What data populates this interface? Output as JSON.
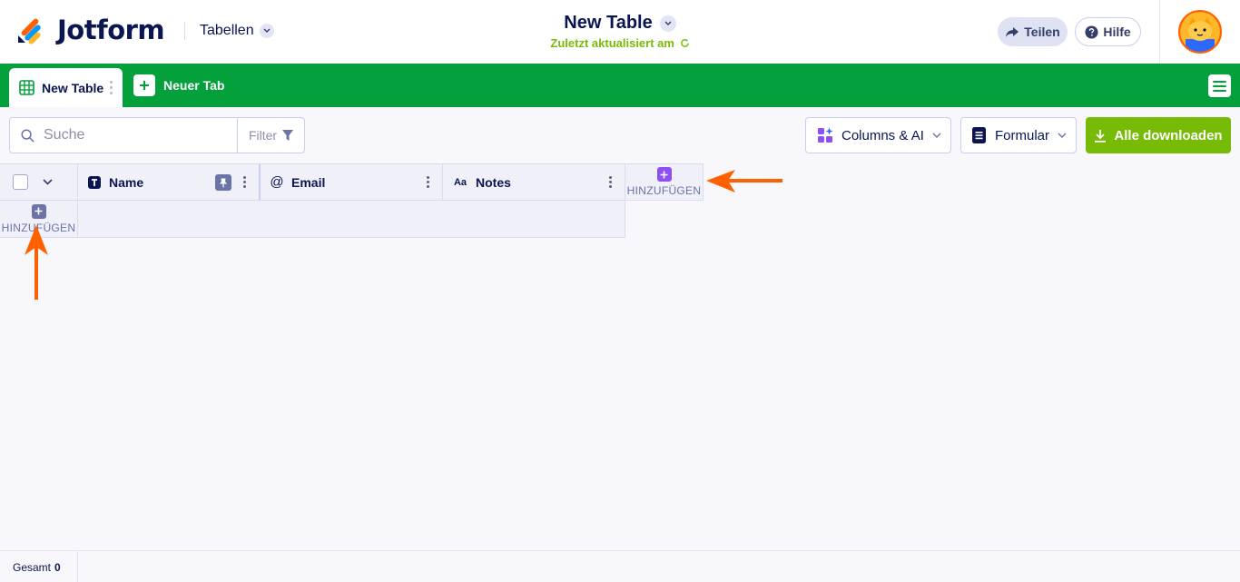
{
  "header": {
    "logo_text": "Jotform",
    "section_label": "Tabellen",
    "doc_title": "New Table",
    "updated_text": "Zuletzt aktualisiert am",
    "share_label": "Teilen",
    "help_label": "Hilfe"
  },
  "tabs": {
    "active_label": "New Table",
    "new_tab_label": "Neuer Tab"
  },
  "toolbar": {
    "search_placeholder": "Suche",
    "filter_label": "Filter",
    "columns_label": "Columns & AI",
    "form_label": "Formular",
    "download_label": "Alle downloaden"
  },
  "table": {
    "columns": [
      {
        "label": "Name",
        "type": "text"
      },
      {
        "label": "Email",
        "type": "email"
      },
      {
        "label": "Notes",
        "type": "long-text"
      }
    ],
    "add_column_label": "HINZUFÜGEN",
    "add_row_label": "HINZUFÜGEN"
  },
  "footer": {
    "total_label": "Gesamt",
    "total_value": "0"
  },
  "colors": {
    "brand_green": "#03a03b",
    "download_green": "#78bb07",
    "navy": "#0a1551",
    "annotation_orange": "#ff6100",
    "add_purple": "#8e4ff5"
  }
}
